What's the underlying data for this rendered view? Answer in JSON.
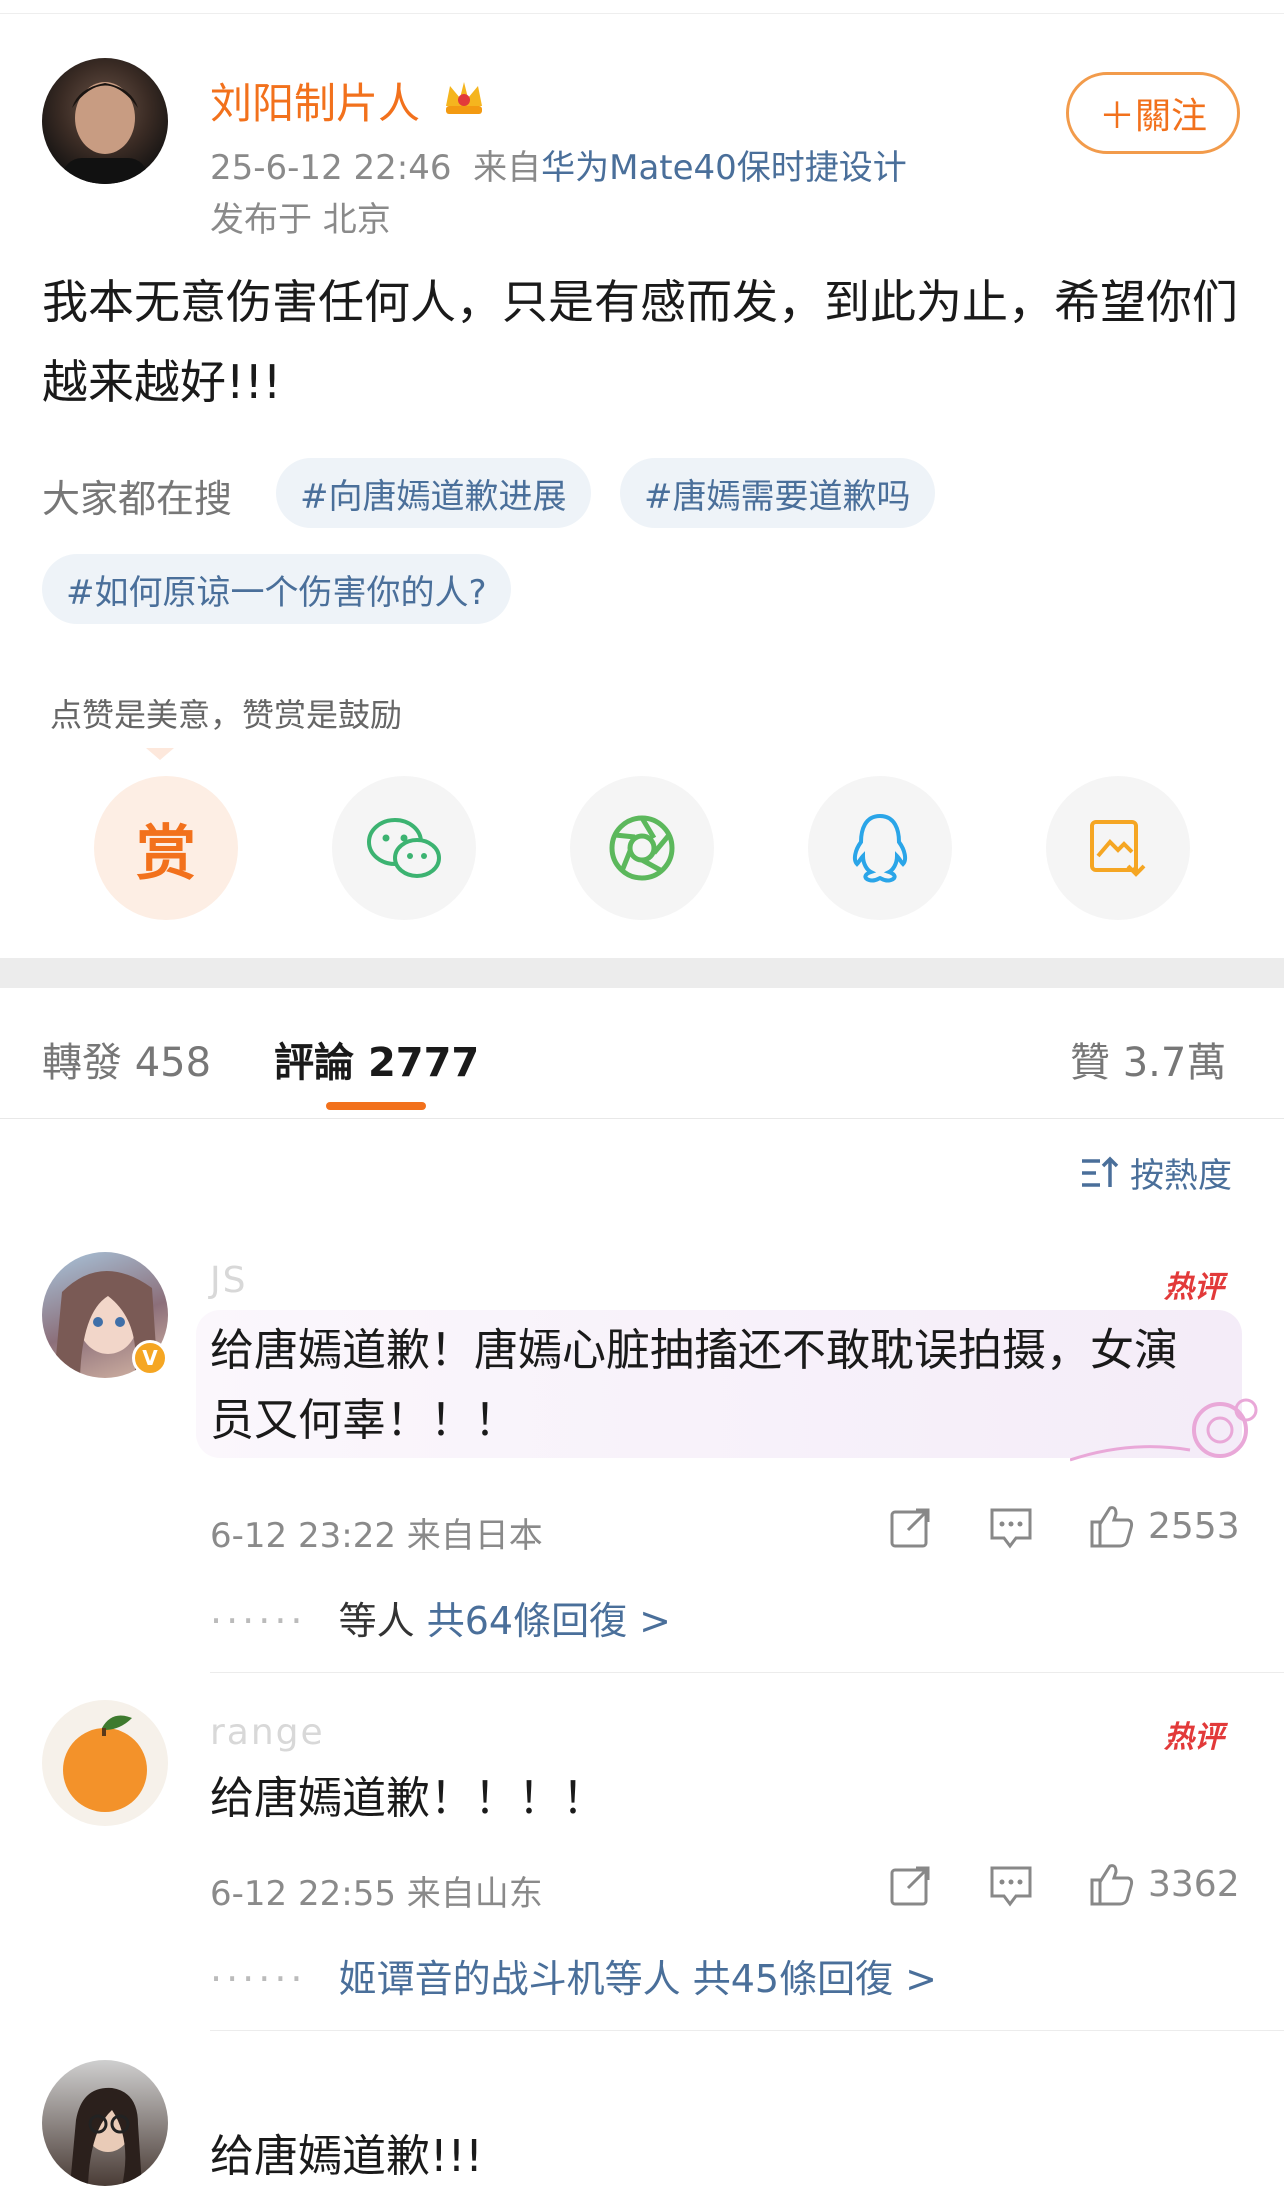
{
  "post": {
    "author": "刘阳制片人",
    "time": "25-6-12 22:46",
    "source_prefix": "来自",
    "source": "华为Mate40保时捷设计",
    "location": "发布于 北京",
    "follow_label": "＋關注",
    "text": "我本无意伤害任何人，只是有感而发，到此为止，希望你们越来越好!!!"
  },
  "search": {
    "label": "大家都在搜",
    "tags": [
      "#向唐嫣道歉进展",
      "#唐嫣需要道歉吗",
      "#如何原谅一个伤害你的人?"
    ]
  },
  "reward": {
    "caption": "点赞是美意，赞赏是鼓励",
    "reward_glyph": "赏",
    "share_icons": [
      "reward-icon",
      "wechat-icon",
      "moments-icon",
      "qq-icon",
      "save-image-icon"
    ]
  },
  "tabs": {
    "repost": "轉發 458",
    "comment_label": "評論",
    "comment_count": "2777",
    "like": "贊 3.7萬",
    "sort": "按熱度"
  },
  "comments": [
    {
      "name": "JS",
      "badge": "热评",
      "text": "给唐嫣道歉！唐嫣心脏抽搐还不敢耽误拍摄，女演员又何辜！！！",
      "meta": "6-12 23:22 来自日本",
      "likes": "2553",
      "reply_prefix": "等人",
      "reply_count": "共64條回復 >"
    },
    {
      "name": "range",
      "badge": "热评",
      "text": "给唐嫣道歉！！！！",
      "meta": "6-12 22:55 来自山东",
      "likes": "3362",
      "reply_users": "姬谭音的战斗机等人",
      "reply_count": "共45條回復 >"
    },
    {
      "name": "",
      "text": "给唐嫣道歉!!!"
    }
  ],
  "colors": {
    "accent": "#f2711c",
    "link": "#4a6f9a",
    "hot": "#e23a3a"
  }
}
